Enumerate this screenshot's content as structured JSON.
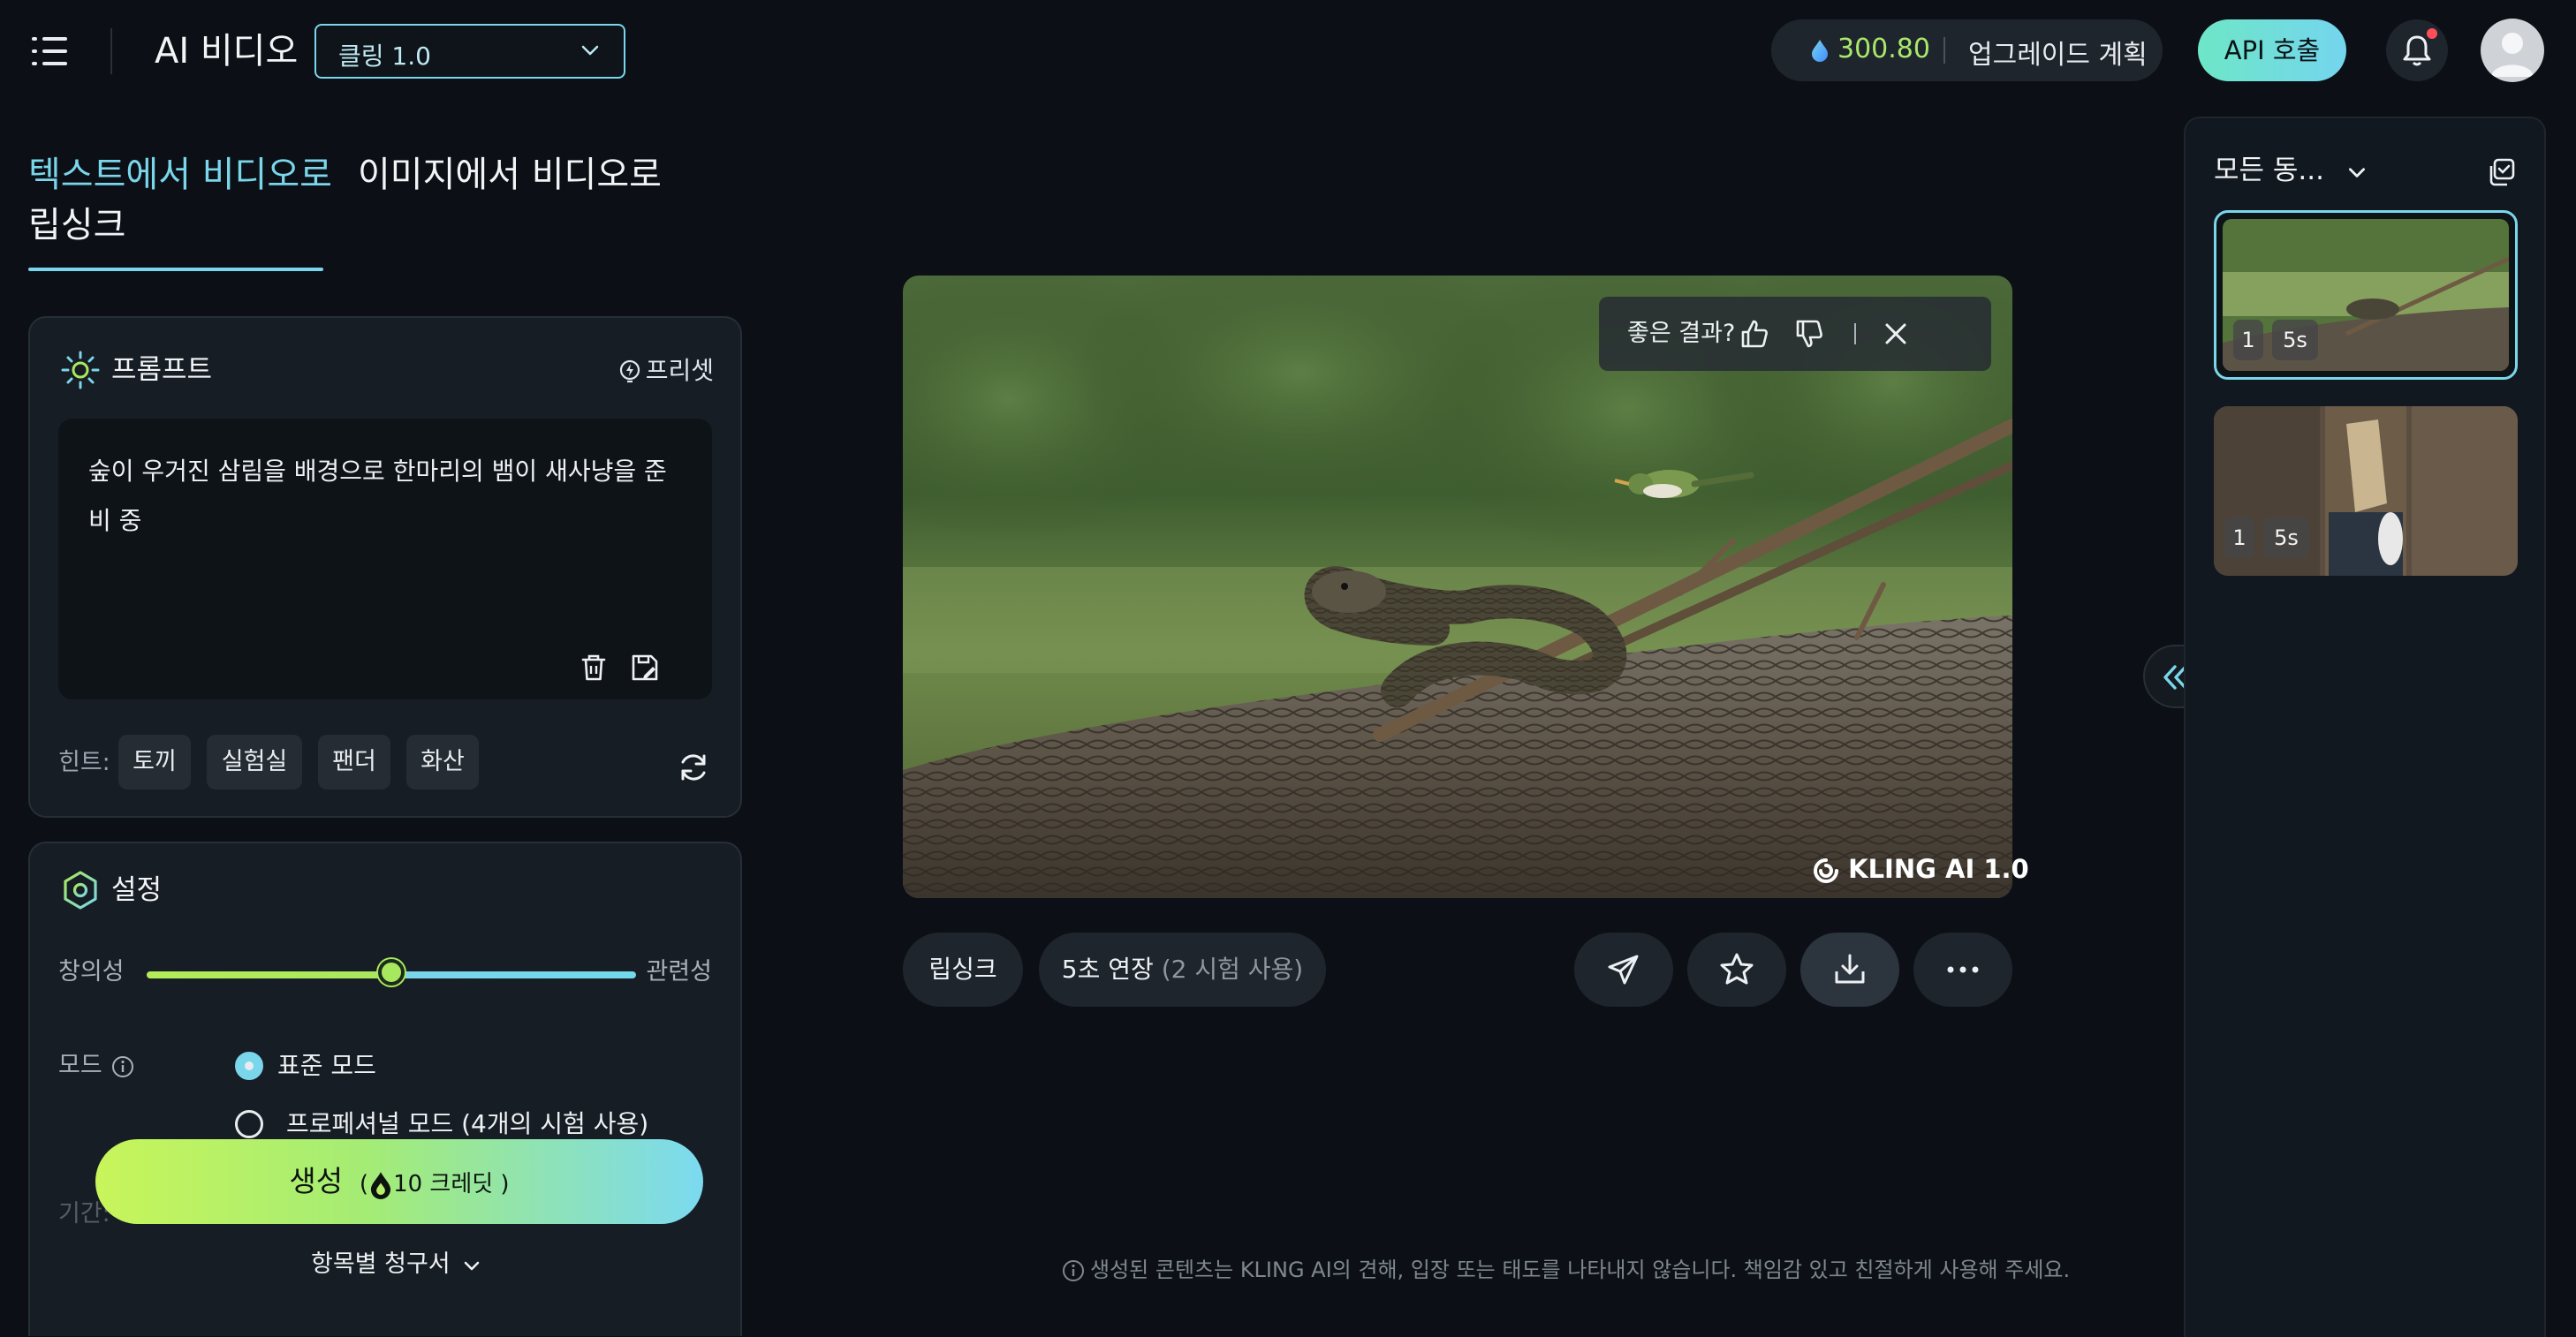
{
  "header": {
    "app_title": "AI 비디오",
    "model_select": "클링 1.0",
    "credits": "300.80",
    "upgrade_label": "업그레이드 계획",
    "api_button": "API 호출"
  },
  "tabs": [
    {
      "label": "텍스트에서 비디오로",
      "active": true
    },
    {
      "label": "이미지에서 비디오로",
      "active": false
    },
    {
      "label": "립싱크",
      "active": false
    }
  ],
  "prompt_panel": {
    "title": "프롬프트",
    "preset_label": "프리셋",
    "prompt_text": "숲이 우거진 삼림을 배경으로 한마리의 뱀이 새사냥을 준비 중",
    "hint_label": "힌트:",
    "hints": [
      "토끼",
      "실험실",
      "팬더",
      "화산"
    ]
  },
  "settings_panel": {
    "title": "설정",
    "slider_left": "창의성",
    "slider_right": "관련성",
    "slider_value": 0.5,
    "mode_label": "모드",
    "modes": [
      {
        "label": "표준 모드",
        "selected": true
      },
      {
        "label": "프로페셔널 모드 (4개의 시험 사용)",
        "selected": false
      }
    ],
    "duration_label": "기간:"
  },
  "generate_button": {
    "label": "생성",
    "credits": "10 크레딧"
  },
  "billing_label": "항목별 청구서",
  "video": {
    "feedback_question": "좋은 결과?",
    "watermark": "KLING AI 1.0"
  },
  "video_actions": {
    "lipsync_label": "립싱크",
    "extend_label": "5초 연장",
    "extend_note": "(2 시험 사용)"
  },
  "disclaimer": "생성된 콘텐츠는 KLING AI의 견해, 입장 또는 태도를 나타내지 않습니다. 책임감 있고 친절하게 사용해 주세요.",
  "right_panel": {
    "title": "모든 동...",
    "items": [
      {
        "count": "1",
        "duration": "5s",
        "selected": true
      },
      {
        "count": "1",
        "duration": "5s",
        "selected": false
      }
    ]
  },
  "colors": {
    "accent": "#7ad6ea",
    "credit_green": "#a9e86a",
    "background": "#0c1016",
    "panel": "#171d24"
  }
}
